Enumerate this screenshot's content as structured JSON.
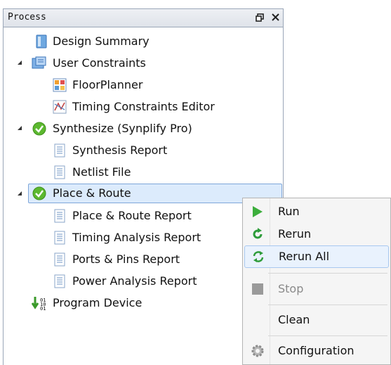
{
  "panel": {
    "title": "Process",
    "restore_glyph": "🗗",
    "close_glyph": "✕"
  },
  "tree": {
    "items": [
      {
        "label": "Design Summary",
        "icon": "summary-icon"
      },
      {
        "label": "User Constraints",
        "icon": "constraints-icon",
        "expanded": true
      },
      {
        "label": "FloorPlanner",
        "icon": "floorplanner-icon"
      },
      {
        "label": "Timing Constraints Editor",
        "icon": "timing-editor-icon"
      },
      {
        "label": "Synthesize (Synplify Pro)",
        "icon": "check-icon",
        "expanded": true
      },
      {
        "label": "Synthesis Report",
        "icon": "report-icon"
      },
      {
        "label": "Netlist File",
        "icon": "report-icon"
      },
      {
        "label": "Place & Route",
        "icon": "check-icon",
        "expanded": true,
        "selected": true
      },
      {
        "label": "Place & Route Report",
        "icon": "report-icon"
      },
      {
        "label": "Timing Analysis Report",
        "icon": "report-icon"
      },
      {
        "label": "Ports & Pins Report",
        "icon": "report-icon"
      },
      {
        "label": "Power Analysis Report",
        "icon": "report-icon"
      },
      {
        "label": "Program Device",
        "icon": "program-device-icon"
      }
    ]
  },
  "context_menu": {
    "items": [
      {
        "label": "Run",
        "icon": "run-icon",
        "enabled": true
      },
      {
        "label": "Rerun",
        "icon": "rerun-icon",
        "enabled": true
      },
      {
        "label": "Rerun All",
        "icon": "rerun-all-icon",
        "enabled": true,
        "hover": true
      },
      {
        "label": "Stop",
        "icon": "stop-icon",
        "enabled": false
      },
      {
        "label": "Clean",
        "icon": "",
        "enabled": true
      },
      {
        "label": "Configuration",
        "icon": "gear-icon",
        "enabled": true
      }
    ]
  },
  "colors": {
    "selection_bg": "#dcebfc",
    "check_green": "#5cb82f",
    "run_green": "#3cae3c",
    "menu_bg": "#f5f5f5"
  }
}
